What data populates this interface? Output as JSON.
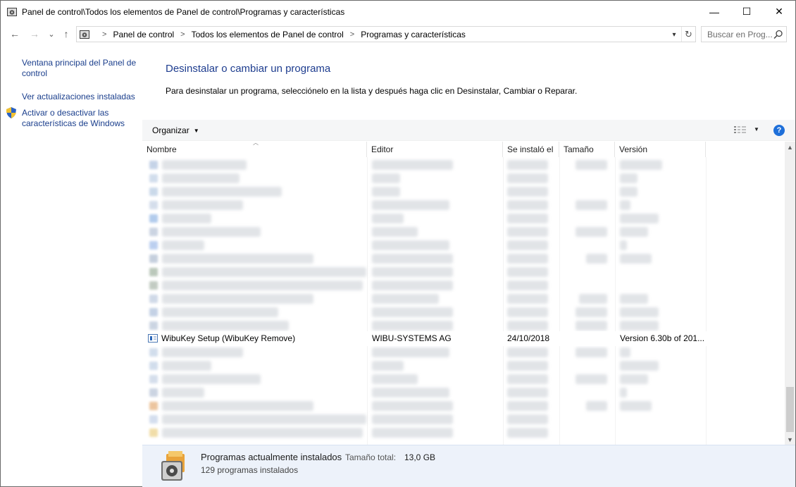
{
  "window": {
    "title": "Panel de control\\Todos los elementos de Panel de control\\Programas y características",
    "minimize": "—",
    "maximize": "☐",
    "close": "✕"
  },
  "nav": {
    "back": "←",
    "forward": "→",
    "recent": "⌄",
    "up": "↑",
    "breadcrumbs": [
      "Panel de control",
      "Todos los elementos de Panel de control",
      "Programas y características"
    ],
    "search_placeholder": "Buscar en Prog..."
  },
  "sidebar": {
    "links": [
      "Ventana principal del Panel de control",
      "Ver actualizaciones instaladas",
      "Activar o desactivar las características de Windows"
    ]
  },
  "main": {
    "title": "Desinstalar o cambiar un programa",
    "description": "Para desinstalar un programa, selecciónelo en la lista y después haga clic en Desinstalar, Cambiar o Reparar."
  },
  "toolbar": {
    "organize": "Organizar",
    "help": "?"
  },
  "table": {
    "columns": [
      "Nombre",
      "Editor",
      "Se instaló el",
      "Tamaño",
      "Versión"
    ],
    "visible_row": {
      "name": "WibuKey Setup (WibuKey Remove)",
      "publisher": "WIBU-SYSTEMS AG",
      "installed_on": "24/10/2018",
      "size": "",
      "version": "Version 6.30b of 201..."
    }
  },
  "details": {
    "title": "Programas actualmente instalados",
    "size_label": "Tamaño total:",
    "size_value": "13,0 GB",
    "count": "129 programas instalados"
  },
  "colors": {
    "link": "#1a3e8c",
    "title_blue": "#1e3d8f",
    "details_bg": "#edf2fa",
    "help_blue": "#1e6fd9"
  }
}
